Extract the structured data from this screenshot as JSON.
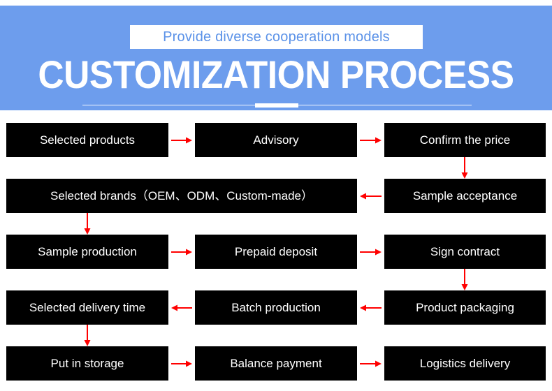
{
  "header": {
    "subtitle": "Provide diverse cooperation models",
    "title": "CUSTOMIZATION PROCESS",
    "background_color": "#6d9ded",
    "subtitle_text_color": "#5b92e8",
    "title_color": "#ffffff"
  },
  "flow": {
    "node_bg_color": "#000000",
    "node_text_color": "#ffffff",
    "arrow_color": "#ff0000",
    "nodes": [
      {
        "id": "selected-products",
        "label": "Selected products"
      },
      {
        "id": "advisory",
        "label": "Advisory"
      },
      {
        "id": "confirm-the-price",
        "label": "Confirm the price"
      },
      {
        "id": "selected-brands",
        "label": "Selected brands（OEM、ODM、Custom-made）"
      },
      {
        "id": "sample-acceptance",
        "label": "Sample acceptance"
      },
      {
        "id": "sample-production",
        "label": "Sample production"
      },
      {
        "id": "prepaid-deposit",
        "label": "Prepaid deposit"
      },
      {
        "id": "sign-contract",
        "label": "Sign contract"
      },
      {
        "id": "selected-delivery-time",
        "label": "Selected delivery time"
      },
      {
        "id": "batch-production",
        "label": "Batch production"
      },
      {
        "id": "product-packaging",
        "label": "Product packaging"
      },
      {
        "id": "put-in-storage",
        "label": "Put in storage"
      },
      {
        "id": "balance-payment",
        "label": "Balance payment"
      },
      {
        "id": "logistics-delivery",
        "label": "Logistics delivery"
      }
    ],
    "connectors": [
      {
        "from": "selected-products",
        "to": "advisory",
        "direction": "right"
      },
      {
        "from": "advisory",
        "to": "confirm-the-price",
        "direction": "right"
      },
      {
        "from": "confirm-the-price",
        "to": "sample-acceptance",
        "direction": "down"
      },
      {
        "from": "sample-acceptance",
        "to": "selected-brands",
        "direction": "left"
      },
      {
        "from": "selected-brands",
        "to": "sample-production",
        "direction": "down"
      },
      {
        "from": "sample-production",
        "to": "prepaid-deposit",
        "direction": "right"
      },
      {
        "from": "prepaid-deposit",
        "to": "sign-contract",
        "direction": "right"
      },
      {
        "from": "sign-contract",
        "to": "product-packaging",
        "direction": "down"
      },
      {
        "from": "product-packaging",
        "to": "batch-production",
        "direction": "left"
      },
      {
        "from": "batch-production",
        "to": "selected-delivery-time",
        "direction": "left"
      },
      {
        "from": "selected-delivery-time",
        "to": "put-in-storage",
        "direction": "down"
      },
      {
        "from": "put-in-storage",
        "to": "balance-payment",
        "direction": "right"
      },
      {
        "from": "balance-payment",
        "to": "logistics-delivery",
        "direction": "right"
      }
    ]
  }
}
